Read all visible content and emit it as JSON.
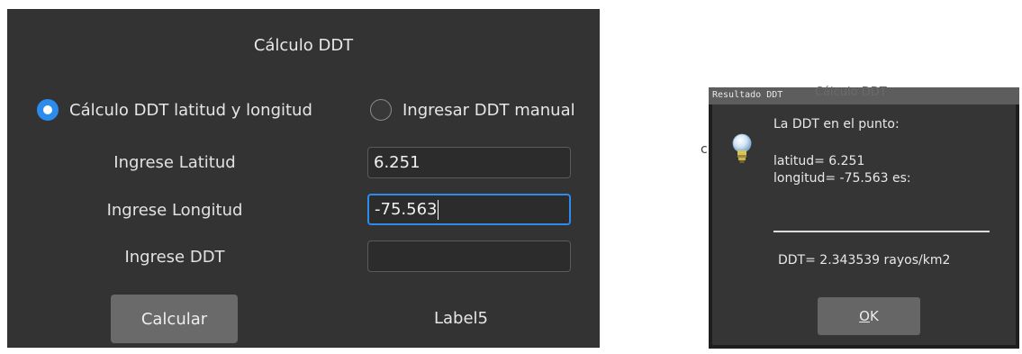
{
  "main_window": {
    "title": "Cálculo DDT",
    "radio_latlon": {
      "label": "Cálculo DDT latitud y longitud",
      "selected": true
    },
    "radio_manual": {
      "label": "Ingresar DDT manual",
      "selected": false
    },
    "fields": {
      "latitude": {
        "label": "Ingrese Latitud",
        "value": "6.251"
      },
      "longitude": {
        "label": "Ingrese Longitud",
        "value": "-75.563"
      },
      "ddt": {
        "label": "Ingrese DDT",
        "value": ""
      }
    },
    "calculate_button": "Calcular",
    "result_label": "Label5"
  },
  "result_dialog": {
    "title": "Resultado DDT",
    "background_title": "Cálculo DDT",
    "icon": "lightbulb-icon",
    "line1": "La DDT en el punto:",
    "line2": "latitud= 6.251",
    "line3": "longitud= -75.563 es:",
    "result": "DDT= 2.343539 rayos/km2",
    "ok_button": {
      "mnemonic": "O",
      "rest": "K"
    }
  },
  "colors": {
    "window_bg": "#333333",
    "accent": "#2b8cee",
    "button": "#6a6a6a"
  }
}
